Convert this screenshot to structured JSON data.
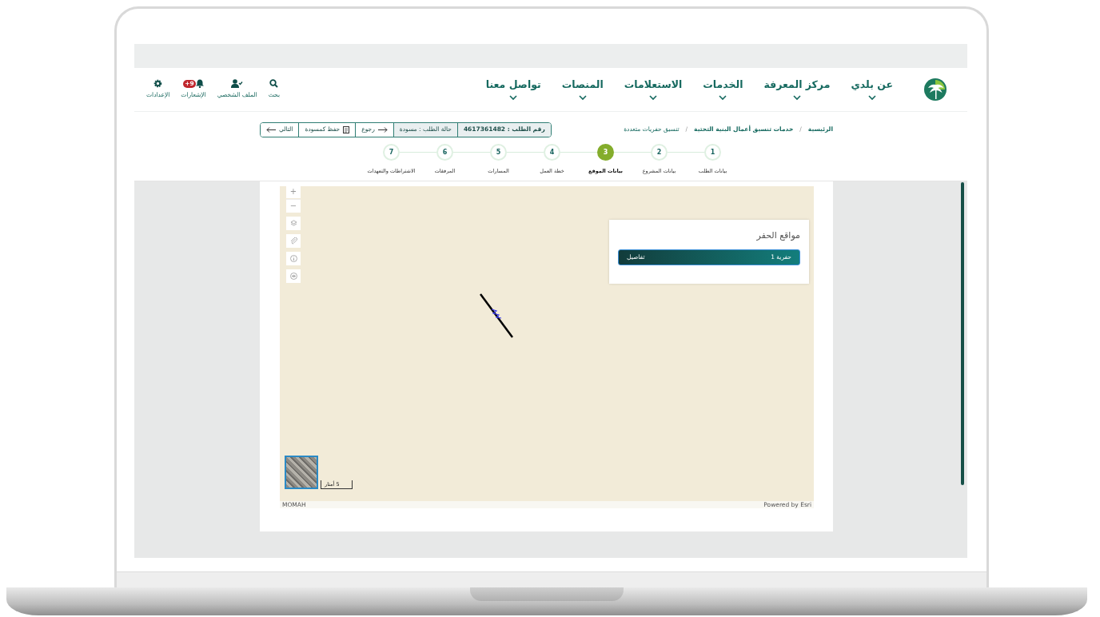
{
  "header": {
    "nav": [
      {
        "label": "عن بلدي"
      },
      {
        "label": "مركز المعرفة"
      },
      {
        "label": "الخدمات"
      },
      {
        "label": "الاستعلامات"
      },
      {
        "label": "المنصات"
      },
      {
        "label": "تواصل معنا"
      }
    ],
    "actions": [
      {
        "kind": "search",
        "label": "بحث"
      },
      {
        "kind": "profile",
        "label": "الملف الشخصي"
      },
      {
        "kind": "notifications",
        "label": "الإشعارات",
        "badge": "+9"
      },
      {
        "kind": "settings",
        "label": "الإعدادات"
      }
    ]
  },
  "breadcrumb": [
    "الرئيسية",
    "خدمات تنسيق أعمال البنية التحتية",
    "تنسيق حفريات متعددة"
  ],
  "breadcrumb_separators": [
    "/",
    "/"
  ],
  "request_bar": {
    "number": "رقم الطلب : 4617361482",
    "status": "حالة الطلب : مسودة",
    "buttons": [
      {
        "kind": "back",
        "label": "رجوع"
      },
      {
        "kind": "save",
        "label": "حفظ كمسودة"
      },
      {
        "kind": "next",
        "label": "التالي"
      }
    ]
  },
  "steps": [
    {
      "number": "1",
      "label": "بيانات الطلب",
      "selected": false
    },
    {
      "number": "2",
      "label": "بيانات المشروع",
      "selected": false
    },
    {
      "number": "3",
      "label": "بيانات الموقع",
      "selected": true
    },
    {
      "number": "4",
      "label": "خطة العمل",
      "selected": false
    },
    {
      "number": "5",
      "label": "المسارات",
      "selected": false
    },
    {
      "number": "6",
      "label": "المرفقات",
      "selected": false
    },
    {
      "number": "7",
      "label": "الاشتراطات والتعهدات",
      "selected": false
    }
  ],
  "map": {
    "controls": [
      {
        "kind": "zoom_in",
        "label": "+"
      },
      {
        "kind": "zoom_out",
        "label": "−"
      },
      {
        "kind": "layers"
      },
      {
        "kind": "attach"
      },
      {
        "kind": "info"
      },
      {
        "kind": "locate"
      }
    ],
    "panel": {
      "title": "مواقع الحفر",
      "items": [
        {
          "label": "حفرية 1",
          "action": "تفاصيل"
        }
      ]
    },
    "scale": "5 أمتار",
    "attribution_left": "MOMAH",
    "attribution_right": "Powered by Esri"
  }
}
